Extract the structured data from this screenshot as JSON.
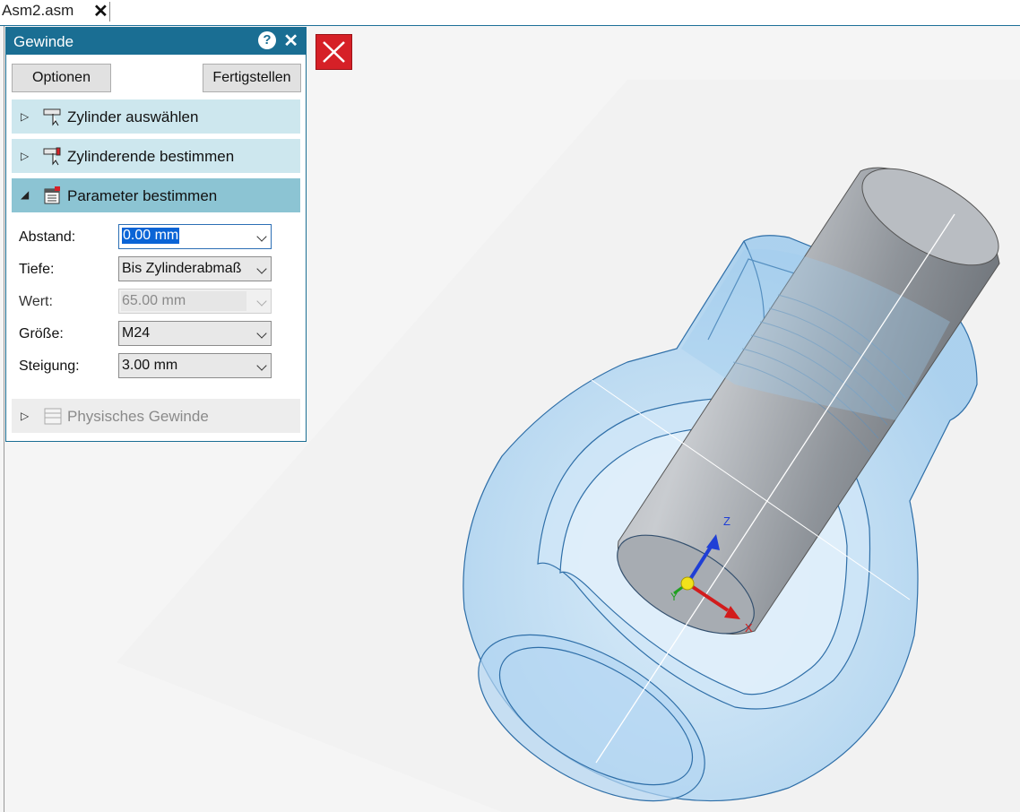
{
  "tab": {
    "label": "Asm2.asm"
  },
  "panel": {
    "title": "Gewinde",
    "buttons": {
      "options": "Optionen",
      "finish": "Fertigstellen"
    },
    "steps": [
      {
        "label": "Zylinder auswählen",
        "state": "collapsed"
      },
      {
        "label": "Zylinderende bestimmen",
        "state": "collapsed"
      },
      {
        "label": "Parameter bestimmen",
        "state": "expanded"
      },
      {
        "label": "Physisches Gewinde",
        "state": "disabled"
      }
    ],
    "params": {
      "abstand": {
        "label": "Abstand:",
        "value": "0.00 mm"
      },
      "tiefe": {
        "label": "Tiefe:",
        "value": "Bis Zylinderabmaß"
      },
      "wert": {
        "label": "Wert:",
        "value": "65.00 mm"
      },
      "groesse": {
        "label": "Größe:",
        "value": "M24"
      },
      "steigung": {
        "label": "Steigung:",
        "value": "3.00 mm"
      }
    }
  },
  "triad": {
    "z": "Z",
    "x": "X",
    "y": "Y"
  },
  "colors": {
    "accent": "#1a6e93",
    "step_active": "#8cc4d3",
    "step_inactive": "#cde7ee",
    "cancel": "#d62027"
  }
}
